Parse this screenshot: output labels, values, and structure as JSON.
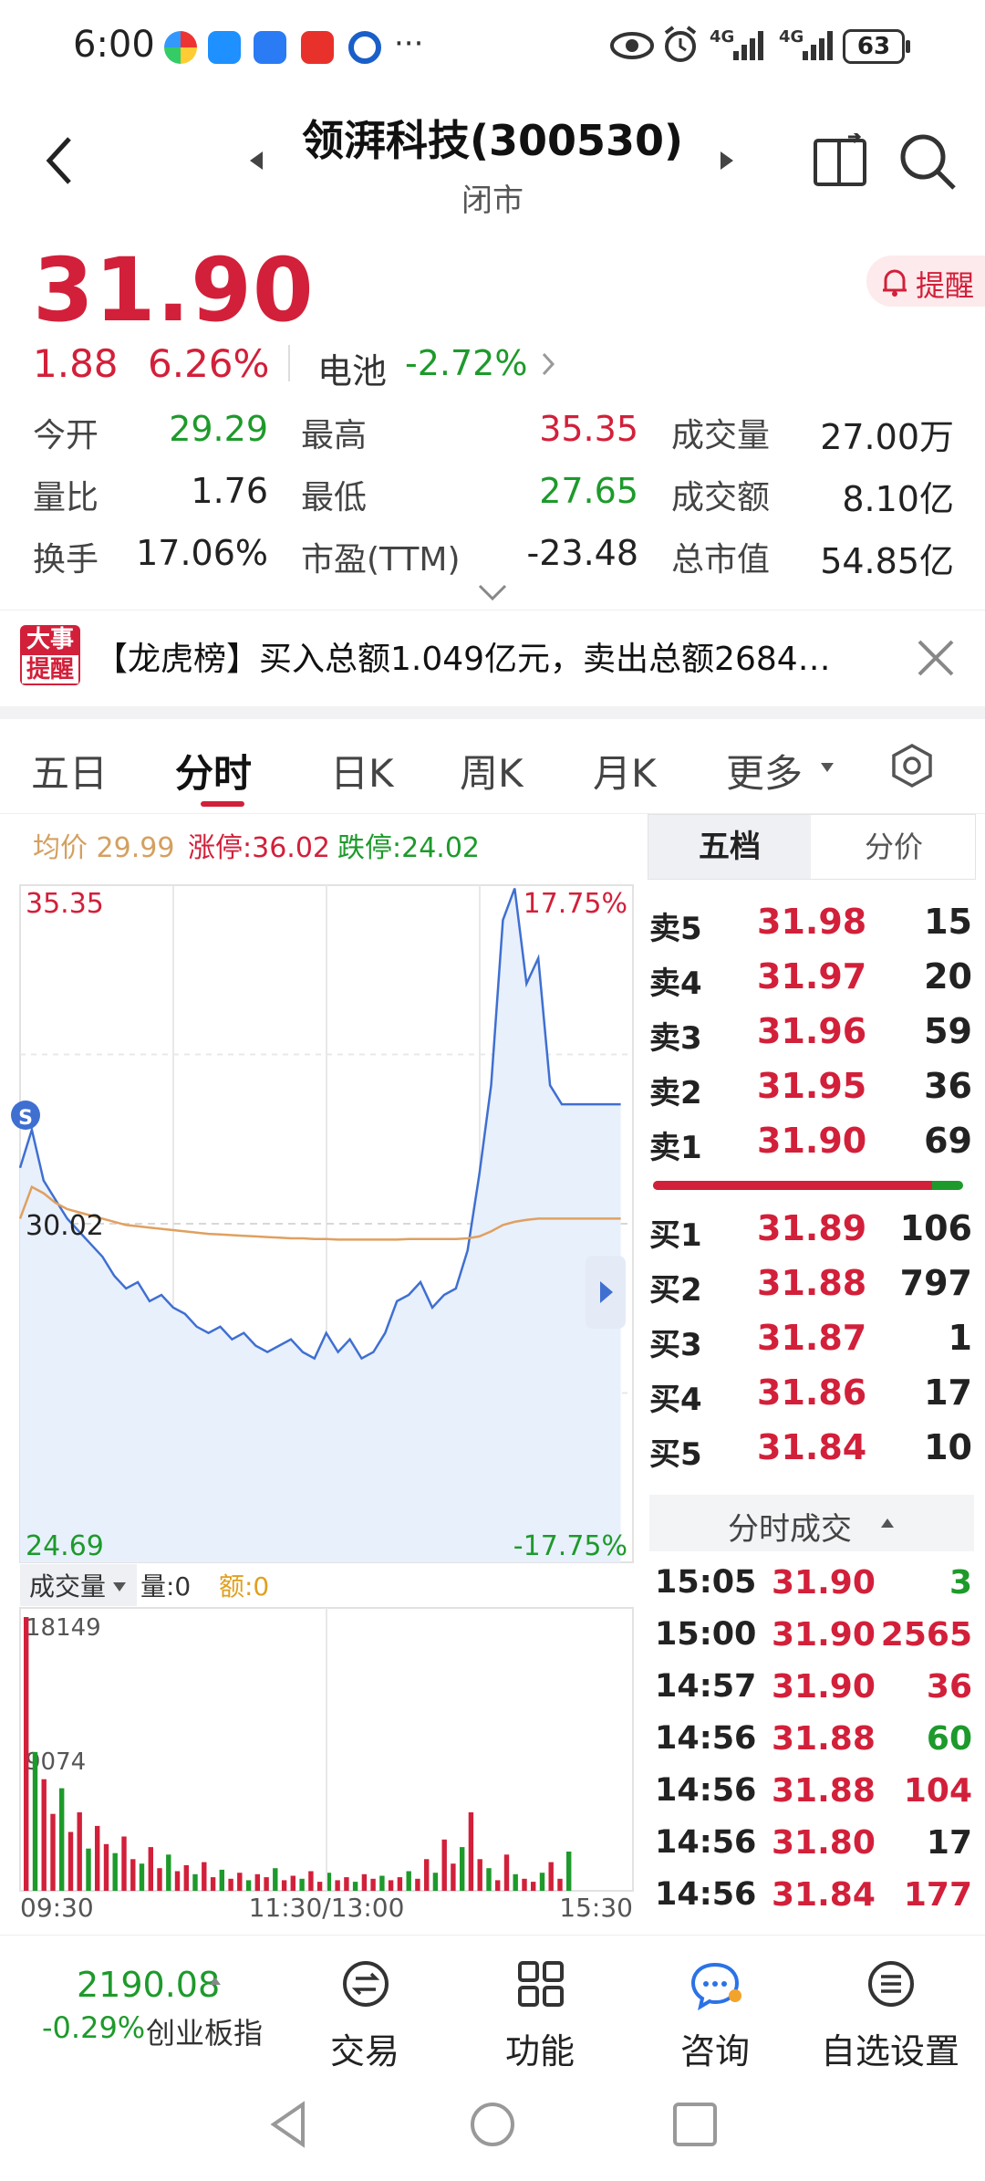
{
  "status_bar": {
    "time": "6:00",
    "more": "···",
    "net1": "4G",
    "net2": "4G",
    "battery": "63"
  },
  "header": {
    "title": "领湃科技(300530)",
    "state": "闭市"
  },
  "quote": {
    "price": "31.90",
    "change": "1.88",
    "change_pct": "6.26%",
    "sector_name": "电池",
    "sector_pct": "-2.72%",
    "alert_label": "提醒"
  },
  "stats": [
    [
      {
        "label": "今开",
        "value": "29.29",
        "color": "green"
      },
      {
        "label": "最高",
        "value": "35.35",
        "color": "red"
      },
      {
        "label": "成交量",
        "value": "27.00万",
        "color": "black"
      }
    ],
    [
      {
        "label": "量比",
        "value": "1.76",
        "color": "black"
      },
      {
        "label": "最低",
        "value": "27.65",
        "color": "green"
      },
      {
        "label": "成交额",
        "value": "8.10亿",
        "color": "black"
      }
    ],
    [
      {
        "label": "换手",
        "value": "17.06%",
        "color": "black"
      },
      {
        "label": "市盈(TTM)",
        "value": "-23.48",
        "color": "black"
      },
      {
        "label": "总市值",
        "value": "54.85亿",
        "color": "black"
      }
    ]
  ],
  "news": {
    "badge_top": "大事",
    "badge_bottom": "提醒",
    "text": "【龙虎榜】买入总额1.049亿元，卖出总额2684…"
  },
  "tabs": [
    "五日",
    "分时",
    "日K",
    "周K",
    "月K",
    "更多"
  ],
  "chart_info": {
    "avg_label": "均价",
    "avg_value": "29.99",
    "limit_up": "涨停:36.02",
    "limit_down": "跌停:24.02"
  },
  "chart_data": {
    "type": "line",
    "price_axis": {
      "top": "35.35",
      "ref": "30.02",
      "bottom": "24.69",
      "top_pct": "17.75%",
      "bottom_pct": "-17.75%"
    },
    "ylim": [
      24.69,
      35.35
    ],
    "reference_price": 30.02,
    "time_labels": [
      "09:30",
      "11:30/13:00",
      "15:30"
    ],
    "price_series": [
      30.9,
      31.5,
      30.7,
      30.4,
      30.1,
      29.9,
      29.7,
      29.5,
      29.2,
      29.0,
      29.1,
      28.8,
      28.9,
      28.7,
      28.6,
      28.4,
      28.3,
      28.4,
      28.2,
      28.3,
      28.1,
      28.0,
      28.1,
      28.2,
      28.0,
      27.9,
      28.3,
      28.0,
      28.2,
      27.9,
      28.0,
      28.3,
      28.8,
      28.9,
      29.1,
      28.7,
      28.9,
      29.0,
      29.6,
      30.8,
      32.2,
      34.8,
      35.3,
      33.8,
      34.2,
      32.2,
      31.9,
      31.9,
      31.9,
      31.9,
      31.9,
      31.9
    ],
    "avg_series": [
      30.1,
      30.6,
      30.5,
      30.35,
      30.25,
      30.2,
      30.15,
      30.1,
      30.05,
      30.0,
      29.98,
      29.96,
      29.94,
      29.92,
      29.9,
      29.88,
      29.86,
      29.85,
      29.84,
      29.83,
      29.82,
      29.81,
      29.8,
      29.79,
      29.79,
      29.78,
      29.78,
      29.77,
      29.77,
      29.77,
      29.77,
      29.77,
      29.77,
      29.78,
      29.78,
      29.78,
      29.78,
      29.78,
      29.79,
      29.82,
      29.9,
      30.0,
      30.05,
      30.08,
      30.1,
      30.1,
      30.1,
      30.1,
      30.1,
      30.1,
      30.1,
      30.1
    ],
    "volume_axis": {
      "label": "成交量",
      "vol_label": "量:0",
      "amt_label": "额:0",
      "max": "18149",
      "mid": "9074"
    },
    "volume_series": [
      18149,
      9200,
      7400,
      5100,
      6800,
      3900,
      5200,
      2800,
      4300,
      3100,
      2500,
      3600,
      2100,
      1800,
      2900,
      1500,
      2400,
      1300,
      1700,
      1100,
      1900,
      900,
      1400,
      800,
      1200,
      700,
      1100,
      900,
      1500,
      700,
      1000,
      800,
      1300,
      600,
      1200,
      700,
      900,
      600,
      1100,
      800,
      1000,
      700,
      900,
      1300,
      800,
      2100,
      1200,
      3400,
      1800,
      2900,
      5200,
      2100,
      1500,
      700,
      2400,
      1100,
      800,
      600,
      1200,
      1900,
      800,
      2600
    ]
  },
  "order_book": {
    "tab_active": "五档",
    "tab_other": "分价",
    "asks": [
      {
        "label": "卖5",
        "price": "31.98",
        "vol": "15"
      },
      {
        "label": "卖4",
        "price": "31.97",
        "vol": "20"
      },
      {
        "label": "卖3",
        "price": "31.96",
        "vol": "59"
      },
      {
        "label": "卖2",
        "price": "31.95",
        "vol": "36"
      },
      {
        "label": "卖1",
        "price": "31.90",
        "vol": "69"
      }
    ],
    "bids": [
      {
        "label": "买1",
        "price": "31.89",
        "vol": "106"
      },
      {
        "label": "买2",
        "price": "31.88",
        "vol": "797"
      },
      {
        "label": "买3",
        "price": "31.87",
        "vol": "1"
      },
      {
        "label": "买4",
        "price": "31.86",
        "vol": "17"
      },
      {
        "label": "买5",
        "price": "31.84",
        "vol": "10"
      }
    ],
    "buy_ratio": 0.9
  },
  "trades": {
    "title": "分时成交",
    "rows": [
      {
        "time": "15:05",
        "price": "31.90",
        "vol": "3",
        "color": "green"
      },
      {
        "time": "15:00",
        "price": "31.90",
        "vol": "2565",
        "color": "red"
      },
      {
        "time": "14:57",
        "price": "31.90",
        "vol": "36",
        "color": "red"
      },
      {
        "time": "14:56",
        "price": "31.88",
        "vol": "60",
        "color": "green"
      },
      {
        "time": "14:56",
        "price": "31.88",
        "vol": "104",
        "color": "red"
      },
      {
        "time": "14:56",
        "price": "31.80",
        "vol": "17",
        "color": "black"
      },
      {
        "time": "14:56",
        "price": "31.84",
        "vol": "177",
        "color": "red"
      }
    ]
  },
  "index_box": {
    "value": "2190.08",
    "pct": "-0.29%",
    "name": "创业板指"
  },
  "bottom_nav": [
    "交易",
    "功能",
    "咨询",
    "自选设置"
  ],
  "colors": {
    "up": "#d2203a",
    "down": "#1d9a2b",
    "price_line": "#3f6fd1",
    "avg_line": "#e0a060",
    "fill": "#e8f0fc"
  }
}
